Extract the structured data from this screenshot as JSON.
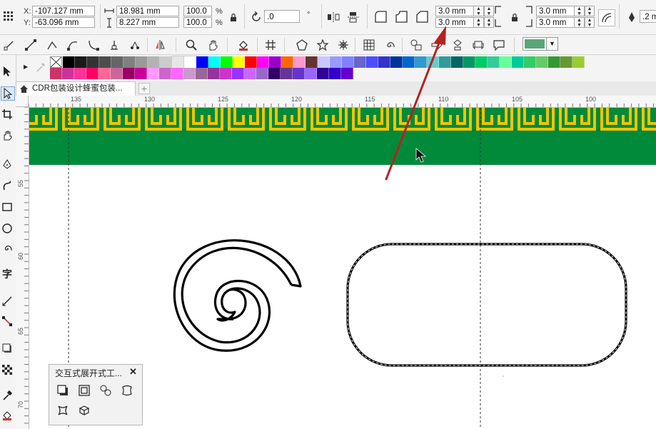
{
  "property_bar": {
    "x_label": "X:",
    "y_label": "Y:",
    "x_value": "-107.127 mm",
    "y_value": "-63.096 mm",
    "width_value": "18.981 mm",
    "height_value": "8.227 mm",
    "scale_x": "100.0",
    "scale_y": "100.0",
    "percent_symbol": "%",
    "rotation_value": ".0",
    "corner_radius_top_left": "3.0 mm",
    "corner_radius_bottom_left": "3.0 mm",
    "corner_radius_top_right": "3.0 mm",
    "corner_radius_bottom_right": "3.0 mm",
    "outline_width": ".2 m"
  },
  "palette": {
    "row1": [
      "#000000",
      "#1a1a1a",
      "#333333",
      "#4d4d4d",
      "#666666",
      "#808080",
      "#999999",
      "#b3b3b3",
      "#cccccc",
      "#e6e6e6",
      "#ffffff",
      "#0000ff",
      "#00ffff",
      "#00ff00",
      "#ffff00",
      "#ff0000",
      "#ff00ff",
      "#9900cc",
      "#ff6600",
      "#ff99cc",
      "#663333",
      "#c8c8ff",
      "#9999ff",
      "#8080ff",
      "#6666cc",
      "#4d4dff",
      "#3333cc",
      "#003399",
      "#0066cc",
      "#3399cc",
      "#66cccc",
      "#339999",
      "#006666",
      "#009966",
      "#00cc66",
      "#33cc99",
      "#66ff99",
      "#00cc99",
      "#33cc66",
      "#66cc66",
      "#339933",
      "#669933",
      "#99cc33"
    ],
    "row2": [
      "#cc3366",
      "#cc3399",
      "#ff3399",
      "#ff0066",
      "#ff6699",
      "#cc6699",
      "#990066",
      "#cc0099",
      "#ff99ff",
      "#cc66cc",
      "#ff66ff",
      "#cc99cc",
      "#996699",
      "#993399",
      "#cc33cc",
      "#9933ff",
      "#cc66ff",
      "#9966cc",
      "#330066",
      "#663399",
      "#6633cc",
      "#9966ff",
      "#330099",
      "#3300cc",
      "#6600cc"
    ]
  },
  "tabs": [
    {
      "label": "CDR包装设计蜂蜜包装..."
    }
  ],
  "ruler": {
    "h_labels": [
      "135",
      "130",
      "125",
      "120",
      "115",
      "110",
      "105",
      "100"
    ],
    "v_labels": [
      "55",
      "60",
      "65",
      "70"
    ]
  },
  "docker": {
    "title": "交互式展开式工...",
    "close": "✕"
  },
  "colors": {
    "band_green": "#008a3a",
    "band_yellow": "#f2c400",
    "fill_swatch": "#5aa578",
    "arrow_red": "#b52222"
  }
}
